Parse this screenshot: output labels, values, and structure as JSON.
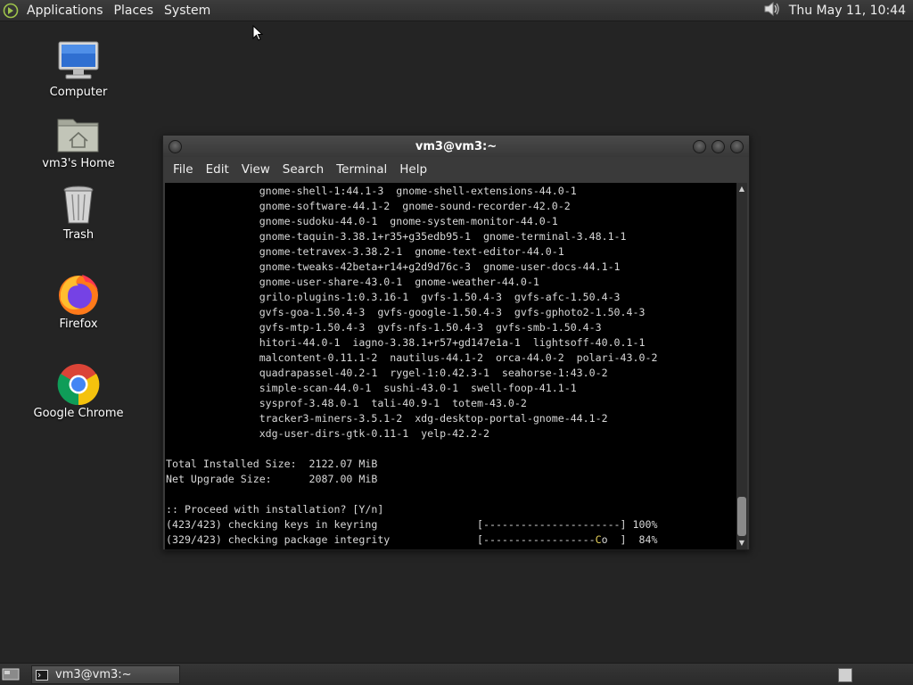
{
  "top_panel": {
    "menus": [
      "Applications",
      "Places",
      "System"
    ],
    "clock": "Thu May 11, 10:44",
    "volume_icon": "speaker-icon"
  },
  "desktop_icons": [
    {
      "label": "Computer",
      "icon": "computer-icon"
    },
    {
      "label": "vm3's Home",
      "icon": "home-folder-icon"
    },
    {
      "label": "Trash",
      "icon": "trash-icon"
    },
    {
      "label": "Firefox",
      "icon": "firefox-icon"
    },
    {
      "label": "Google Chrome",
      "icon": "chrome-icon"
    }
  ],
  "terminal": {
    "title": "vm3@vm3:~",
    "menu": [
      "File",
      "Edit",
      "View",
      "Search",
      "Terminal",
      "Help"
    ],
    "lines": [
      "               gnome-shell-1:44.1-3  gnome-shell-extensions-44.0-1",
      "               gnome-software-44.1-2  gnome-sound-recorder-42.0-2",
      "               gnome-sudoku-44.0-1  gnome-system-monitor-44.0-1",
      "               gnome-taquin-3.38.1+r35+g35edb95-1  gnome-terminal-3.48.1-1",
      "               gnome-tetravex-3.38.2-1  gnome-text-editor-44.0-1",
      "               gnome-tweaks-42beta+r14+g2d9d76c-3  gnome-user-docs-44.1-1",
      "               gnome-user-share-43.0-1  gnome-weather-44.0-1",
      "               grilo-plugins-1:0.3.16-1  gvfs-1.50.4-3  gvfs-afc-1.50.4-3",
      "               gvfs-goa-1.50.4-3  gvfs-google-1.50.4-3  gvfs-gphoto2-1.50.4-3",
      "               gvfs-mtp-1.50.4-3  gvfs-nfs-1.50.4-3  gvfs-smb-1.50.4-3",
      "               hitori-44.0-1  iagno-3.38.1+r57+gd147e1a-1  lightsoff-40.0.1-1",
      "               malcontent-0.11.1-2  nautilus-44.1-2  orca-44.0-2  polari-43.0-2",
      "               quadrapassel-40.2-1  rygel-1:0.42.3-1  seahorse-1:43.0-2",
      "               simple-scan-44.0-1  sushi-43.0-1  swell-foop-41.1-1",
      "               sysprof-3.48.0-1  tali-40.9-1  totem-43.0-2",
      "               tracker3-miners-3.5.1-2  xdg-desktop-portal-gnome-44.1-2",
      "               xdg-user-dirs-gtk-0.11-1  yelp-42.2-2",
      "",
      "Total Installed Size:  2122.07 MiB",
      "Net Upgrade Size:      2087.00 MiB",
      "",
      ":: Proceed with installation? [Y/n]",
      "(423/423) checking keys in keyring                [----------------------] 100%"
    ],
    "last_line_prefix": "(329/423) checking package integrity              [------------------",
    "last_line_pacman": "C",
    "last_line_dot": "o",
    "last_line_suffix": "  ]  84%"
  },
  "taskbar": {
    "task_label": "vm3@vm3:~"
  }
}
